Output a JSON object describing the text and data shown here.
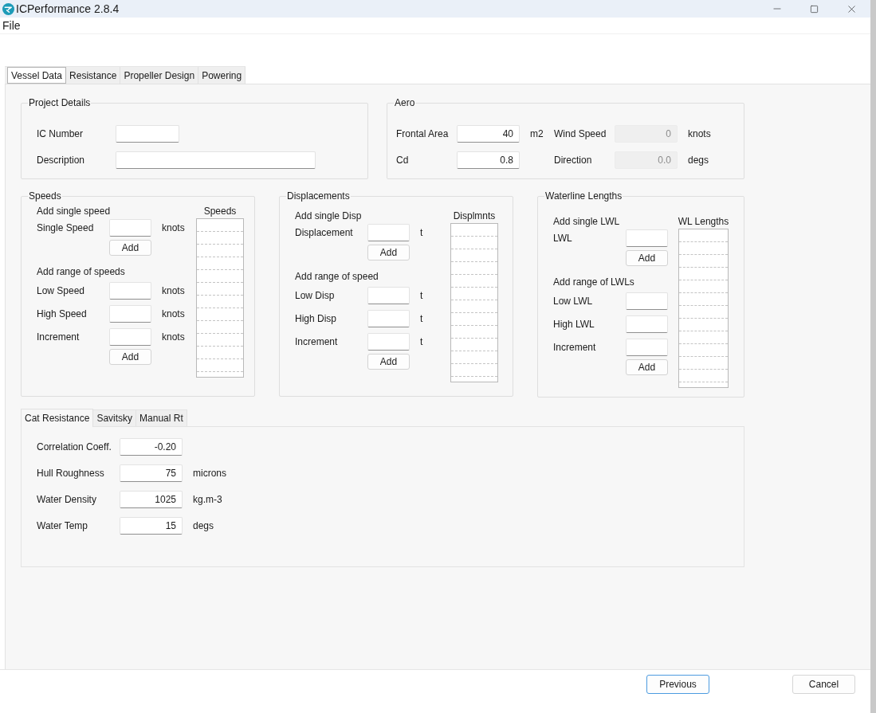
{
  "window": {
    "title": "ICPerformance 2.8.4"
  },
  "menu": [
    "File"
  ],
  "tabs": [
    {
      "label": "Vessel Data",
      "selected": true
    },
    {
      "label": "Resistance",
      "selected": false
    },
    {
      "label": "Propeller Design",
      "selected": false
    },
    {
      "label": "Powering",
      "selected": false
    }
  ],
  "project_details": {
    "title": "Project Details",
    "fields": [
      {
        "label": "IC Number",
        "kind": "short"
      },
      {
        "label": "Description",
        "kind": "long"
      }
    ]
  },
  "aero": {
    "title": "Aero",
    "fields": [
      {
        "label": "Frontal Area",
        "value": "40",
        "unit": "m2",
        "disabled": false
      },
      {
        "label": "Wind Speed",
        "value": "0",
        "unit": "knots",
        "disabled": true
      },
      {
        "label": "Cd",
        "value": "0.8",
        "disabled": false
      },
      {
        "label": "Direction",
        "value": "0.0",
        "unit": "degs",
        "disabled": true
      }
    ]
  },
  "groups": [
    {
      "title": "Speeds",
      "single_heading": "Add single speed",
      "single_field": {
        "label": "Single Speed",
        "unit": "knots"
      },
      "single_button": "Add",
      "range_heading": "Add range of speeds",
      "range_fields": [
        {
          "label": "Low Speed",
          "unit": "knots"
        },
        {
          "label": "High Speed",
          "unit": "knots"
        },
        {
          "label": "Increment",
          "unit": "knots"
        }
      ],
      "range_button": "Add",
      "list_heading": "Speeds"
    },
    {
      "title": "Displacements",
      "single_heading": "Add single Disp",
      "single_field": {
        "label": "Displacement",
        "unit": "t"
      },
      "single_button": "Add",
      "range_heading": "Add range of speed",
      "range_fields": [
        {
          "label": "Low Disp",
          "unit": "t"
        },
        {
          "label": "High Disp",
          "unit": "t"
        },
        {
          "label": "Increment",
          "unit": "t"
        }
      ],
      "range_button": "Add",
      "list_heading": "Displmnts"
    },
    {
      "title": "Waterline Lengths",
      "single_heading": "Add single LWL",
      "single_field": {
        "label": "LWL"
      },
      "single_button": "Add",
      "range_heading": "Add range of LWLs",
      "range_fields": [
        {
          "label": "Low LWL"
        },
        {
          "label": "High LWL"
        },
        {
          "label": "Increment"
        }
      ],
      "range_button": "Add",
      "list_heading": "WL Lengths"
    }
  ],
  "resistance_tabs": [
    {
      "label": "Cat Resistance",
      "selected": true
    },
    {
      "label": "Savitsky",
      "selected": false
    },
    {
      "label": "Manual Rt",
      "selected": false
    }
  ],
  "resistance_fields": [
    {
      "label": "Correlation Coeff.",
      "value": "-0.20"
    },
    {
      "label": "Hull Roughness",
      "value": "75",
      "unit": "microns"
    },
    {
      "label": "Water Density",
      "value": "1025",
      "unit": "kg.m-3"
    },
    {
      "label": "Water Temp",
      "value": "15",
      "unit": "degs"
    }
  ],
  "buttons": [
    {
      "label": "Previous",
      "focused": true
    },
    {
      "label": "Cancel",
      "focused": false
    }
  ]
}
